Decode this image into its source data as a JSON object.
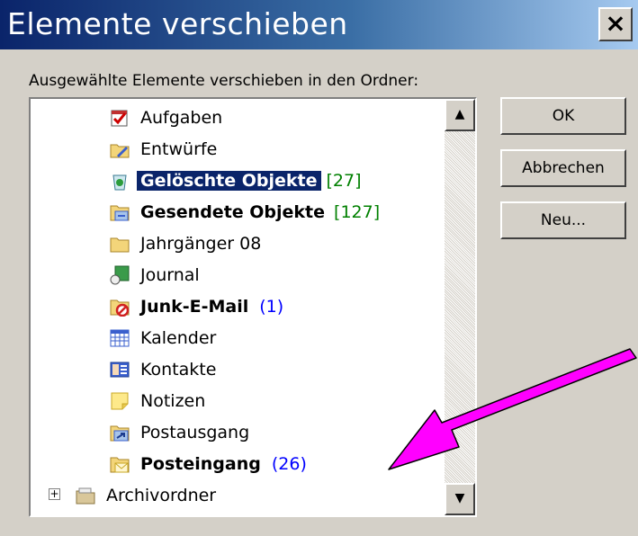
{
  "window": {
    "title": "Elemente verschieben",
    "close_label": "×"
  },
  "prompt": "Ausgewählte Elemente verschieben in den Ordner:",
  "folders": [
    {
      "label": "Aufgaben",
      "icon": "tasks-icon"
    },
    {
      "label": "Entwürfe",
      "icon": "drafts-icon"
    },
    {
      "label": "Gelöschte Objekte",
      "count": "[27]",
      "icon": "trash-icon",
      "bold": true,
      "selected": true
    },
    {
      "label": "Gesendete Objekte",
      "count": "[127]",
      "icon": "sent-folder-icon",
      "bold": true
    },
    {
      "label": "Jahrgänger 08",
      "icon": "folder-icon"
    },
    {
      "label": "Journal",
      "icon": "journal-icon"
    },
    {
      "label": "Junk-E-Mail",
      "count": "(1)",
      "icon": "junk-mail-icon",
      "bold": true
    },
    {
      "label": "Kalender",
      "icon": "calendar-icon"
    },
    {
      "label": "Kontakte",
      "icon": "contacts-icon"
    },
    {
      "label": "Notizen",
      "icon": "notes-icon"
    },
    {
      "label": "Postausgang",
      "icon": "outbox-icon"
    },
    {
      "label": "Posteingang",
      "count": "(26)",
      "icon": "inbox-icon",
      "bold": true
    },
    {
      "label": "Archivordner",
      "icon": "archive-folder-icon"
    }
  ],
  "buttons": {
    "ok": "OK",
    "cancel": "Abbrechen",
    "new": "Neu..."
  },
  "colors": {
    "annotation_arrow": "#ff00ff",
    "selection": "#0a246a",
    "count_unread": "#0000ff",
    "count_total": "#008000"
  }
}
